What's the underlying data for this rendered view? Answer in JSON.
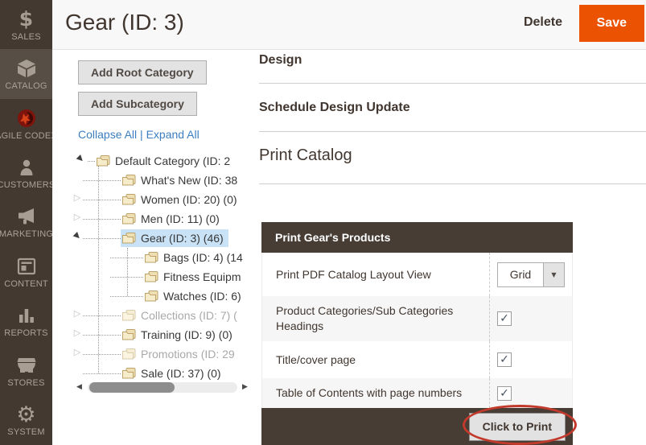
{
  "sidebar": {
    "items": [
      {
        "label": "SALES",
        "icon": "dollar-icon",
        "active": false
      },
      {
        "label": "CATALOG",
        "icon": "box-icon",
        "active": true
      },
      {
        "label": "AGILE CODEX",
        "icon": "agile-codex-logo-icon",
        "active": false
      },
      {
        "label": "CUSTOMERS",
        "icon": "person-icon",
        "active": false
      },
      {
        "label": "MARKETING",
        "icon": "megaphone-icon",
        "active": false
      },
      {
        "label": "CONTENT",
        "icon": "layout-icon",
        "active": false
      },
      {
        "label": "REPORTS",
        "icon": "bar-chart-icon",
        "active": false
      },
      {
        "label": "STORES",
        "icon": "storefront-icon",
        "active": false
      },
      {
        "label": "SYSTEM",
        "icon": "gear-icon",
        "active": false
      }
    ]
  },
  "header": {
    "title": "Gear (ID: 3)",
    "delete_label": "Delete",
    "save_label": "Save"
  },
  "tree_panel": {
    "add_root_label": "Add Root Category",
    "add_sub_label": "Add Subcategory",
    "collapse_all_label": "Collapse All",
    "links_separator": " | ",
    "expand_all_label": "Expand All",
    "nodes": [
      {
        "label": "Default Category (ID: 2",
        "level": 0,
        "expander": "expanded",
        "state": "normal"
      },
      {
        "label": "What's New (ID: 38",
        "level": 1,
        "expander": "none",
        "state": "normal"
      },
      {
        "label": "Women (ID: 20) (0)",
        "level": 1,
        "expander": "collapsed",
        "state": "normal"
      },
      {
        "label": "Men (ID: 11) (0)",
        "level": 1,
        "expander": "collapsed",
        "state": "normal"
      },
      {
        "label": "Gear (ID: 3) (46)",
        "level": 1,
        "expander": "expanded",
        "state": "selected"
      },
      {
        "label": "Bags (ID: 4) (14",
        "level": 2,
        "expander": "none",
        "state": "normal"
      },
      {
        "label": "Fitness Equipm",
        "level": 2,
        "expander": "none",
        "state": "normal"
      },
      {
        "label": "Watches (ID: 6)",
        "level": 2,
        "expander": "none",
        "state": "normal"
      },
      {
        "label": "Collections (ID: 7) (",
        "level": 1,
        "expander": "collapsed",
        "state": "disabled"
      },
      {
        "label": "Training (ID: 9) (0)",
        "level": 1,
        "expander": "collapsed",
        "state": "normal"
      },
      {
        "label": "Promotions (ID: 29",
        "level": 1,
        "expander": "collapsed",
        "state": "disabled"
      },
      {
        "label": "Sale (ID: 37) (0)",
        "level": 1,
        "expander": "none",
        "state": "normal"
      }
    ]
  },
  "sections": [
    {
      "label": "Design"
    },
    {
      "label": "Schedule Design Update"
    },
    {
      "label": "Print Catalog"
    }
  ],
  "print_table": {
    "header": "Print Gear's Products",
    "rows": [
      {
        "label": "Print PDF Catalog Layout View",
        "control": "select",
        "value": "Grid"
      },
      {
        "label": "Product Categories/Sub Categories Headings",
        "control": "checkbox",
        "checked": true
      },
      {
        "label": "Title/cover page",
        "control": "checkbox",
        "checked": true
      },
      {
        "label": "Table of Contents with page numbers",
        "control": "checkbox",
        "checked": true
      }
    ],
    "footer_button": "Click to Print"
  },
  "icons": {
    "checkmark": "✓",
    "select_arrow": "▼",
    "expanded_arrow": "▶",
    "collapsed_arrow": "▷",
    "scroll_left": "◀",
    "scroll_right": "▶",
    "dollar": "$",
    "gear": "⚙"
  },
  "colors": {
    "accent": "#eb5202",
    "dark_brown": "#473d35",
    "sidebar_bg": "#433931",
    "selection_bg": "#c9e2f6",
    "link_blue": "#3c7ebf",
    "annotation_red": "#c23a2b",
    "disabled_text": "#a9a9a9"
  }
}
